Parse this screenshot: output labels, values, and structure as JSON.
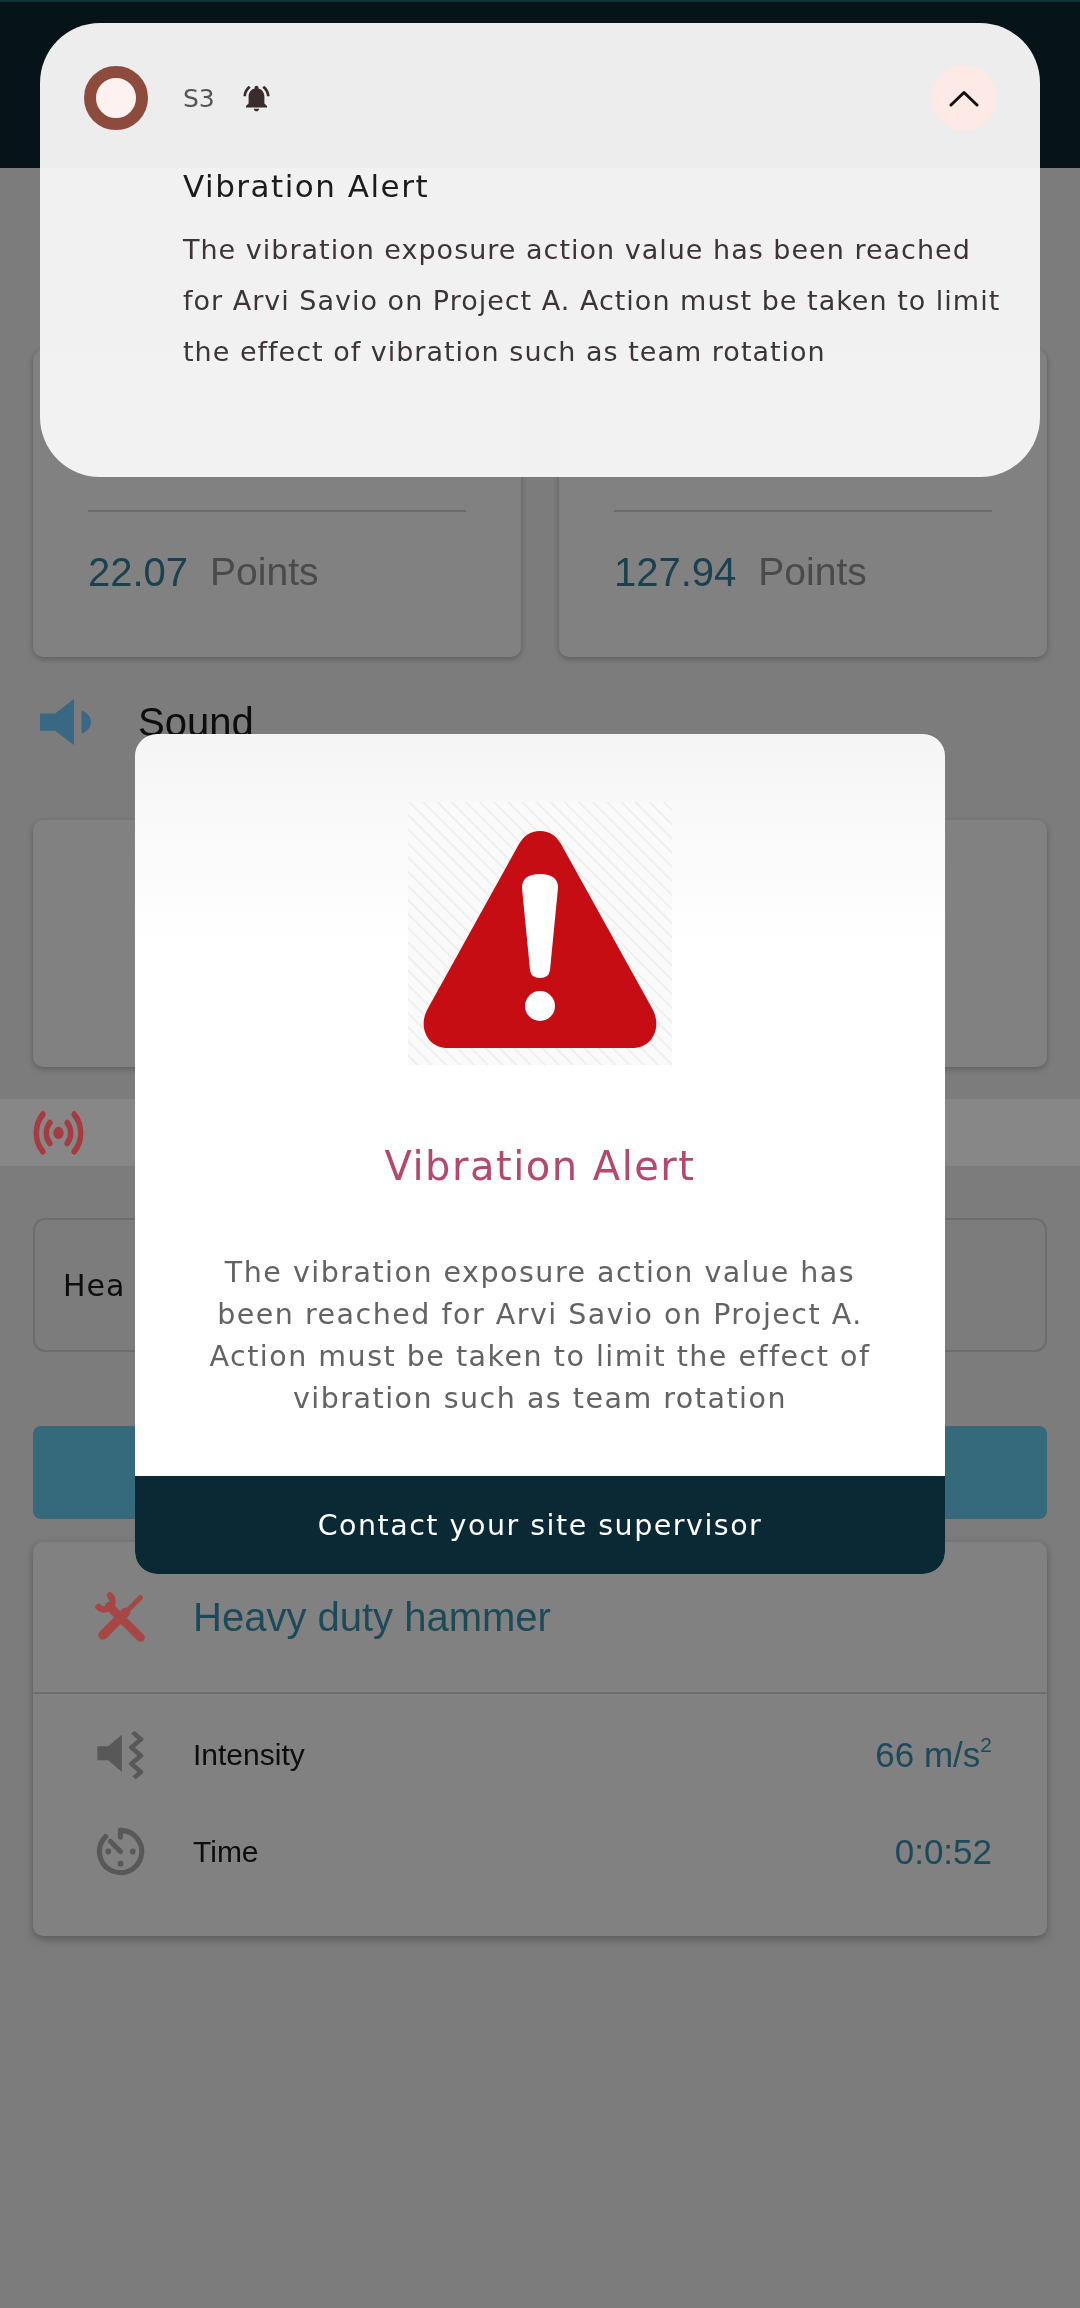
{
  "notification": {
    "app_label": "S3",
    "title": "Vibration Alert",
    "body": "The vibration exposure action value has been reached for Arvi Savio on Project A. Action must be taken to limit the effect of vibration such as team rotation"
  },
  "summary_cards": [
    {
      "value": "22.07",
      "unit": "Points"
    },
    {
      "value": "127.94",
      "unit": "Points"
    }
  ],
  "sound_section": {
    "title": "Sound"
  },
  "vibration_section": {
    "tool_field": {
      "value": "Hea"
    }
  },
  "tool_card": {
    "name": "Heavy duty hammer",
    "rows": [
      {
        "kind": "intensity",
        "label": "Intensity",
        "value": "66 m/s$^{2}$"
      },
      {
        "kind": "time",
        "label": "Time",
        "value": "0:0:52"
      }
    ]
  },
  "alert_dialog": {
    "title": "Vibration Alert",
    "message": "The vibration exposure action value has been reached for Arvi Savio on Project A. Action must be taken to limit the effect of vibration such as team rotation",
    "button": "Contact your site supervisor"
  }
}
